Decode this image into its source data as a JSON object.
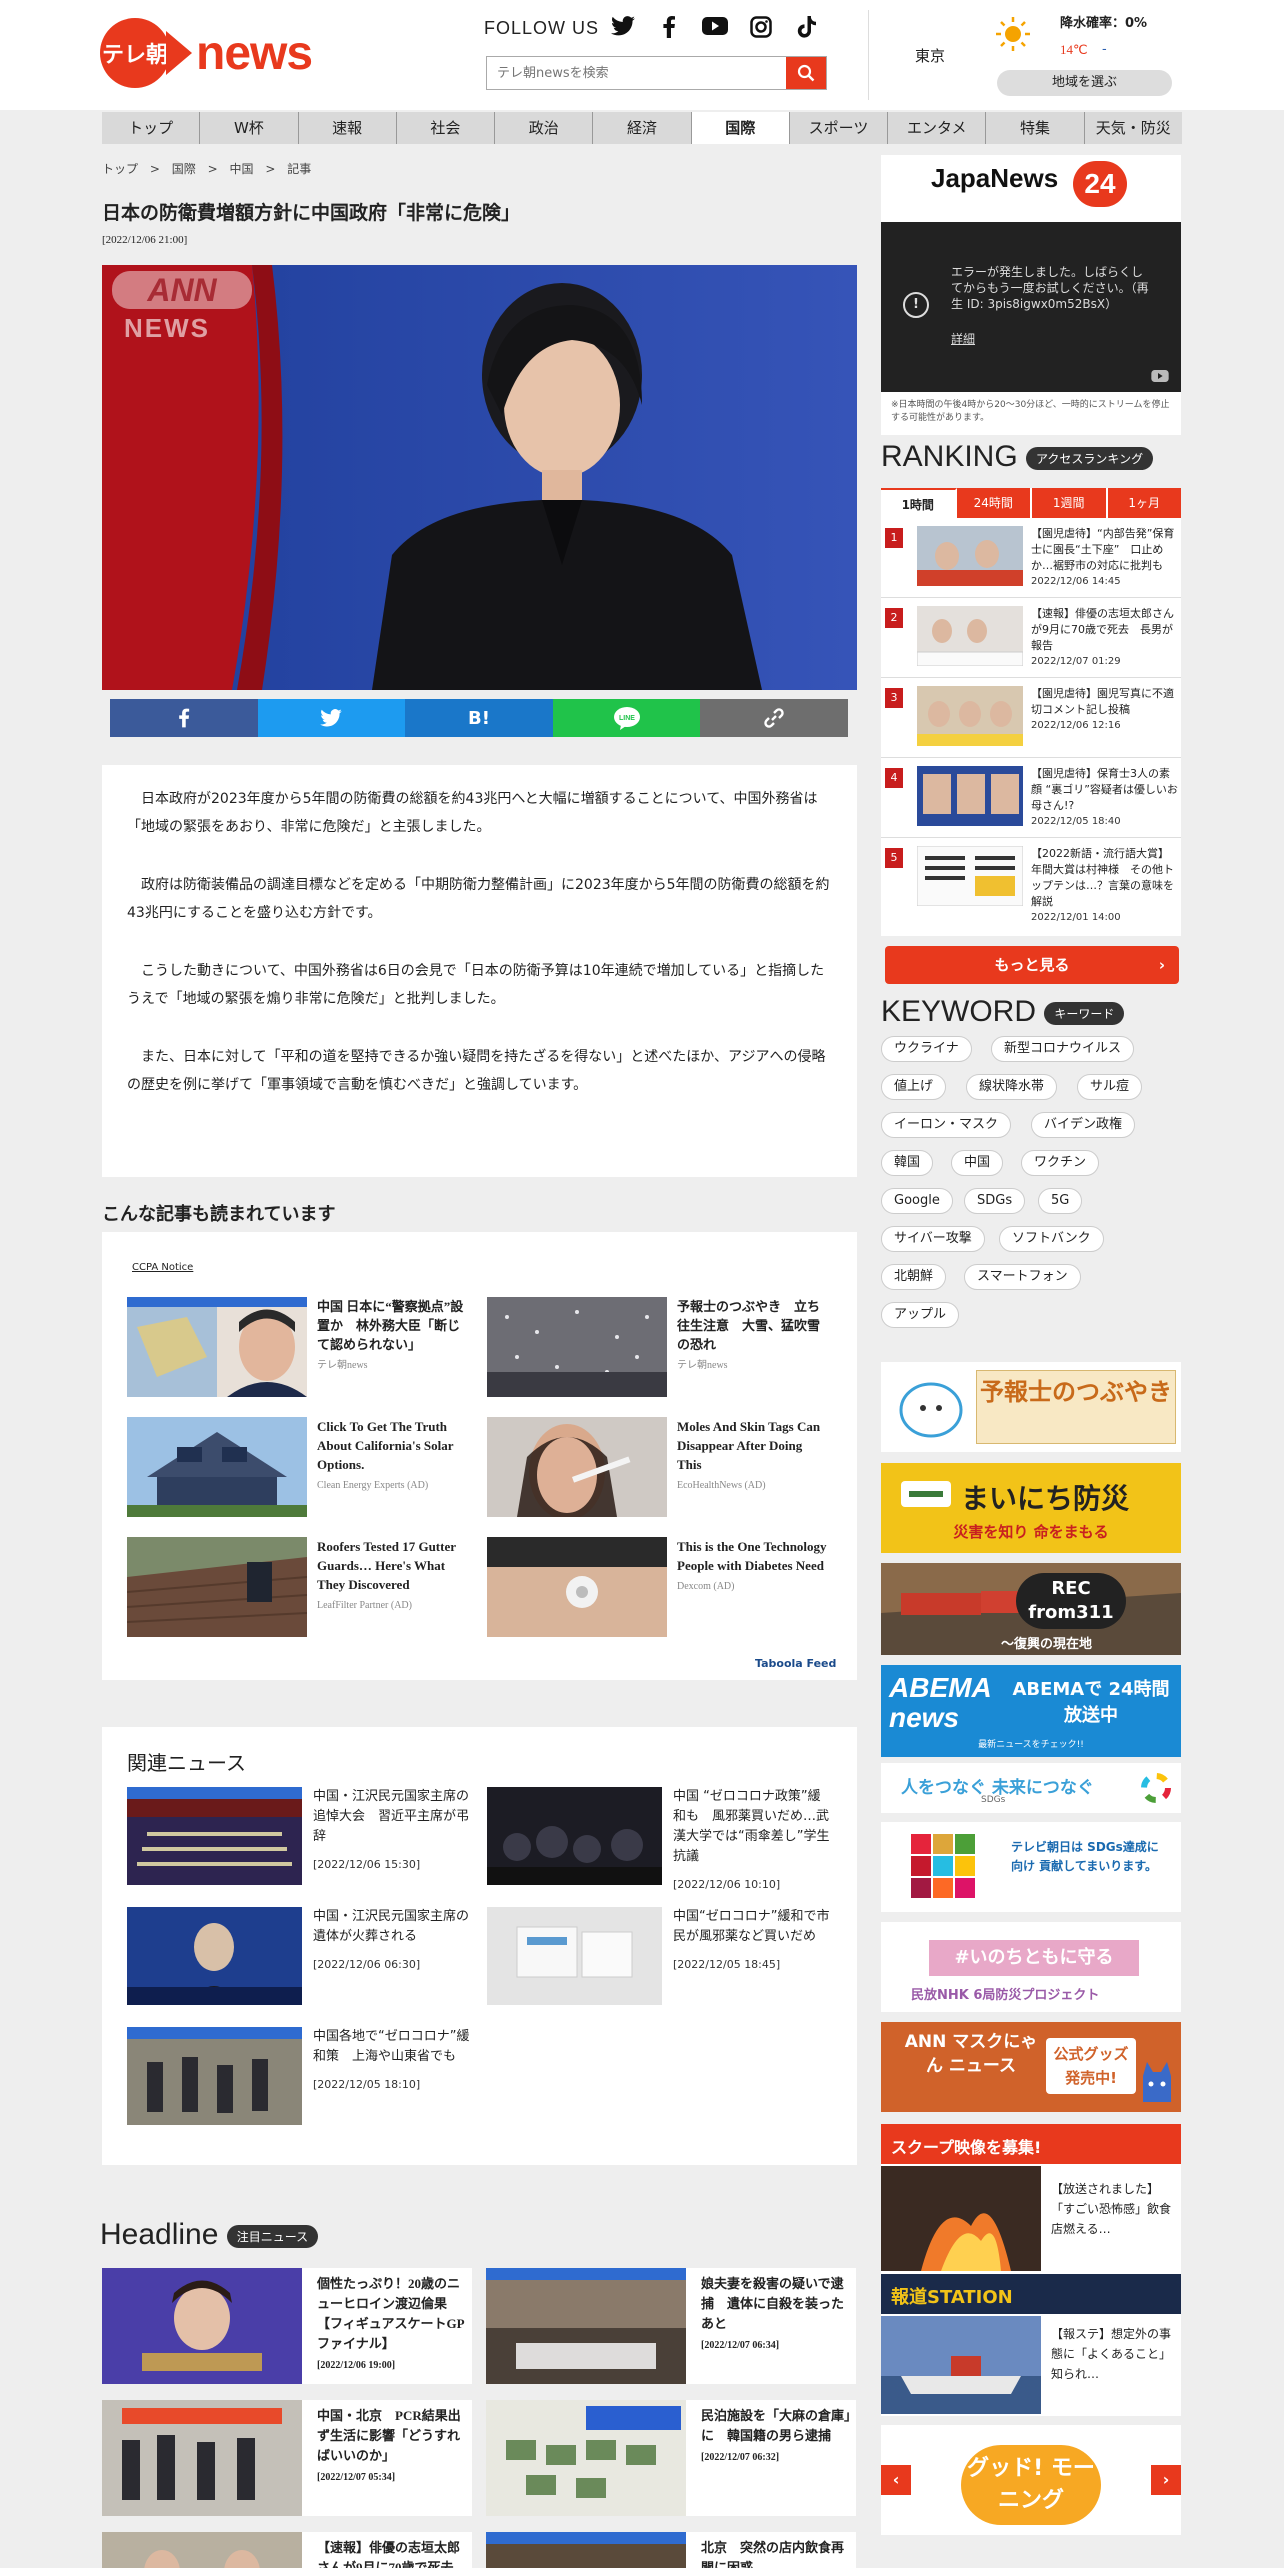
{
  "header": {
    "logo_badge": "テレ朝",
    "logo_text": "news",
    "follow_label": "FOLLOW US",
    "search_placeholder": "テレ朝newsを検索",
    "weather": {
      "city": "東京",
      "rain_label": "降水確率：0%",
      "temp_high": "14℃",
      "temp_low": "-",
      "region_button": "地域を選ぶ"
    }
  },
  "nav": [
    "トップ",
    "W杯",
    "速報",
    "社会",
    "政治",
    "経済",
    "国際",
    "スポーツ",
    "エンタメ",
    "特集",
    "天気・防災"
  ],
  "nav_active": "国際",
  "breadcrumb": [
    "トップ",
    ">",
    "国際",
    ">",
    "中国",
    ">",
    "記事"
  ],
  "article": {
    "title": "日本の防衛費増額方針に中国政府「非常に危険」",
    "date": "[2022/12/06 21:00]",
    "watermark_top": "ANN",
    "watermark_bottom": "NEWS",
    "paragraphs": [
      "日本政府が2023年度から5年間の防衛費の総額を約43兆円へと大幅に増額することについて、中国外務省は「地域の緊張をあおり、非常に危険だ」と主張しました。",
      "政府は防衛装備品の調達目標などを定める「中期防衛力整備計画」に2023年度から5年間の防衛費の総額を約43兆円にすることを盛り込む方針です。",
      "こうした動きについて、中国外務省は6日の会見で「日本の防衛予算は10年連続で増加している」と指摘したうえで「地域の緊張を煽り非常に危険だ」と批判しました。",
      "また、日本に対して「平和の道を堅持できるか強い疑問を持たざるを得ない」と述べたほか、アジアへの侵略の歴史を例に挙げて「軍事領域で言動を慎むべきだ」と強調しています。"
    ],
    "share": [
      "f",
      "tw",
      "B!",
      "LINE",
      "link"
    ]
  },
  "recommend": {
    "title": "こんな記事も読まれています",
    "notice": "CCPA Notice",
    "items": [
      {
        "title": "中国 日本に“警察拠点”設置か　林外務大臣「断じて認められない」",
        "source": "テレ朝news"
      },
      {
        "title": "予報士のつぶやき　立ち往生注意　大雪、猛吹雪の恐れ",
        "source": "テレ朝news"
      },
      {
        "title": "Click To Get The Truth About California's Solar Options.",
        "source": "Clean Energy Experts (AD)"
      },
      {
        "title": "Moles And Skin Tags Can Disappear After Doing This",
        "source": "EcoHealthNews (AD)"
      },
      {
        "title": "Roofers Tested 17 Gutter Guards… Here's What They Discovered",
        "source": "LeafFilter Partner (AD)"
      },
      {
        "title": "This is the One Technology People with Diabetes Need",
        "source": "Dexcom (AD)"
      }
    ],
    "taboola": "Taboola Feed"
  },
  "related": {
    "title": "関連ニュース",
    "items": [
      {
        "title": "中国・江沢民元国家主席の追悼大会　習近平主席が弔辞",
        "date": "[2022/12/06 15:30]"
      },
      {
        "title": "中国 “ゼロコロナ政策”緩和も　風邪薬買いだめ…武漢大学では“雨傘差し”学生抗議",
        "date": "[2022/12/06 10:10]"
      },
      {
        "title": "中国・江沢民元国家主席の遺体が火葬される",
        "date": "[2022/12/06 06:30]"
      },
      {
        "title": "中国“ゼロコロナ”緩和で市民が風邪薬など買いだめ",
        "date": "[2022/12/05 18:45]"
      },
      {
        "title": "中国各地で“ゼロコロナ”緩和策　上海や山東省でも",
        "date": "[2022/12/05 18:10]"
      }
    ]
  },
  "headline": {
    "title": "Headline",
    "pill": "注目ニュース",
    "items": [
      {
        "title": "個性たっぷり！20歳のニューヒロイン渡辺倫果【フィギュアスケートGPファイナル】",
        "date": "[2022/12/06 19:00]"
      },
      {
        "title": "娘夫妻を殺害の疑いで逮捕　遺体に自殺を装ったあと",
        "date": "[2022/12/07 06:34]"
      },
      {
        "title": "中国・北京　PCR結果出ず生活に影響「どうすればいいのか」",
        "date": "[2022/12/07 05:34]"
      },
      {
        "title": "民泊施設を「大麻の倉庫」に　韓国籍の男ら逮捕",
        "date": "[2022/12/07 06:32]"
      },
      {
        "title": "【速報】俳優の志垣太郎さんが9月に70歳で死去",
        "date": ""
      },
      {
        "title": "北京　突然の店内飲食再開に困惑",
        "date": ""
      }
    ]
  },
  "sidebar": {
    "japanews_title": "JapaNews",
    "japanews_num": "24",
    "error_text": "エラーが発生しました。しばらくしてからもう一度お試しください。（再生 ID: 3pis8igwx0m52BsX）",
    "error_link": "詳細",
    "note": "※日本時間の午後4時から20～30分ほど、一時的にストリームを停止する可能性があります。",
    "ranking_title": "RANKING",
    "ranking_pill": "アクセスランキング",
    "ranking_tabs": [
      "1時間",
      "24時間",
      "1週間",
      "1ヶ月"
    ],
    "ranking": [
      {
        "num": "1",
        "title": "【園児虐待】“内部告発”保育士に園長“土下座”　口止めか…裾野市の対応に批判も",
        "date": "2022/12/06 14:45"
      },
      {
        "num": "2",
        "title": "【速報】俳優の志垣太郎さんが9月に70歳で死去　長男が報告",
        "date": "2022/12/07 01:29"
      },
      {
        "num": "3",
        "title": "【園児虐待】園児写真に不適切コメント記し投稿",
        "date": "2022/12/06 12:16"
      },
      {
        "num": "4",
        "title": "【園児虐待】保育士3人の素顔 “裏ゴリ”容疑者は優しいお母さん!?",
        "date": "2022/12/05 18:40"
      },
      {
        "num": "5",
        "title": "【2022新語・流行語大賞】年間大賞は村神様　その他トップテンは…？言葉の意味を解説",
        "date": "2022/12/01 14:00"
      }
    ],
    "more": "もっと見る",
    "keyword_title": "KEYWORD",
    "keyword_pill": "キーワード",
    "keywords": [
      "ウクライナ",
      "新型コロナウイルス",
      "値上げ",
      "線状降水帯",
      "サル痘",
      "イーロン・マスク",
      "バイデン政権",
      "韓国",
      "中国",
      "ワクチン",
      "Google",
      "SDGs",
      "5G",
      "サイバー攻撃",
      "ソフトバンク",
      "北朝鮮",
      "スマートフォン",
      "アップル"
    ],
    "banners": {
      "yoho": "予報士のつぶやき",
      "bosai_title": "まいにち防災",
      "bosai_sub": "災害を知り 命をまもる",
      "rec": "REC from311",
      "rec_sub": "～復興の現在地",
      "abema_left": "ABEMA news",
      "abema_right": "ABEMAで 24時間放送中",
      "abema_sub": "最新ニュースをチェック!!",
      "sdgs": "人をつなぐ 未来につなぐ",
      "sdgs_small": "SDGs",
      "sdgs2": "テレビ朝日は SDGs達成に向け 貢献してまいります。",
      "inochi": "#いのちともに守る",
      "inochi_sub": "民放NHK 6局防災プロジェクト",
      "mask_left": "ANN マスクにゃん ニュース",
      "mask_right": "公式グッズ 発売中!",
      "scoop": "スクープ映像を募集!",
      "scoop_text": "【放送されました】「すごい恐怖感」飲食店燃える…",
      "houdou": "報道STATION",
      "houdou_text": "【報ステ】想定外の事態に「よくあること」知られ…",
      "good": "グッド! モーニング"
    }
  }
}
